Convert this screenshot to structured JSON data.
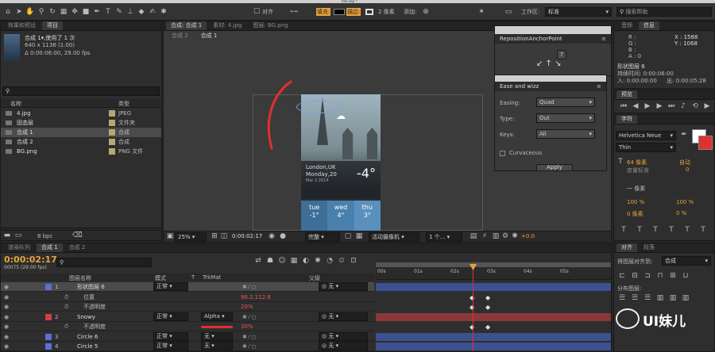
{
  "app": {
    "title": "Ae6.aep *",
    "workspace_label": "工作区:",
    "workspace_value": "标准",
    "search_placeholder": "搜索帮助"
  },
  "toolbar": {
    "align_label": "对齐",
    "fill_label": "填充:",
    "stroke_label": "描边:",
    "stroke_size": "2 像素",
    "add_label": "添加:"
  },
  "project": {
    "tabs": [
      "效果和预设",
      "项目"
    ],
    "comp_name": "合成 1▾,使用了 1 次",
    "comp_size": "640 x 1136 (1.00)",
    "comp_time": "Δ 0:00:06:00, 29.00 fps",
    "headers": {
      "name": "名称",
      "type": "类型"
    },
    "items": [
      {
        "name": "4.jpg",
        "type": "JPEG",
        "color": "#b9a772"
      },
      {
        "name": "固态层",
        "type": "文件夹",
        "color": "#b9a772"
      },
      {
        "name": "合成 1",
        "type": "合成",
        "color": "#b9a772"
      },
      {
        "name": "合成 2",
        "type": "合成",
        "color": "#b9a772"
      },
      {
        "name": "BG.png",
        "type": "PNG 文件",
        "color": "#b9a772"
      }
    ],
    "bpc": "8 bpc"
  },
  "comp_viewer": {
    "tabs": [
      "合成: 合成 1",
      "素材: 4.jpg",
      "图层: BG.png"
    ],
    "flow": [
      "合成 2",
      "合成 1"
    ],
    "zoom": "25%",
    "timecode": "0:00:02:17",
    "quality": "完整",
    "camera": "活动摄像机",
    "views": "1 个...",
    "exposure": "+0.0"
  },
  "phone": {
    "city": "London,UK",
    "day": "Monday,20",
    "date": "Mar 2 2014",
    "temp": "-4°",
    "forecast": [
      {
        "day": "tue",
        "temp": "-1°"
      },
      {
        "day": "wed",
        "temp": "4°"
      },
      {
        "day": "thu",
        "temp": "3°"
      }
    ]
  },
  "anchor_panel": {
    "title": "RepositionAnchorPoint",
    "button": "?"
  },
  "ease_panel": {
    "title": "Ease and wizz",
    "easing_label": "Easing:",
    "easing": "Quad",
    "type_label": "Type:",
    "type": "Out",
    "keys_label": "Keys:",
    "keys": "All",
    "curvaceous": "Curvaceous",
    "apply": "Apply"
  },
  "info": {
    "tabs": [
      "音频",
      "信息"
    ],
    "r": "R :",
    "g": "G :",
    "b": "B :",
    "a": "A : 0",
    "x": "X : 1588",
    "y": "Y : 1068",
    "layer": "形状图层 6",
    "duration": "持续时间: 0:00:06:00",
    "in": "入: 0:00:00:00",
    "out": "出: 0:00:05:28"
  },
  "preview": {
    "title": "预览"
  },
  "character": {
    "title": "字符",
    "font": "Helvetica Neue",
    "style": "Thin",
    "size": "64 像素",
    "auto": "自动",
    "metric": "度量标准",
    "zero": "0",
    "stroke": "一 像素",
    "vscale": "100 %",
    "hscale": "100 %",
    "baseline": "0 像素",
    "tsume": "0 %"
  },
  "timeline": {
    "tabs": [
      "渲染队列",
      "合成 1",
      "合成 2"
    ],
    "time": "0:00:02:17",
    "frames": "00075 (29.00 fps)",
    "headers": {
      "name": "图层名称",
      "mode": "模式",
      "t": "T",
      "trkmat": "TrkMat",
      "parent": "父级"
    },
    "ruler": [
      "00s",
      "01s",
      "02s",
      "03s",
      "04s",
      "05s"
    ],
    "layers": [
      {
        "num": "1",
        "name": "形状图层 6",
        "mode": "正常",
        "trkmat": "",
        "parent": "无",
        "color": "#5a6fd8"
      },
      {
        "num": "",
        "name": "位置",
        "value": "96.2,112.8"
      },
      {
        "num": "",
        "name": "不透明度",
        "value": "20%"
      },
      {
        "num": "2",
        "name": "Snowy",
        "mode": "正常",
        "trkmat": "Alpha",
        "parent": "无",
        "color": "#d04040"
      },
      {
        "num": "",
        "name": "不透明度",
        "value": "30%"
      },
      {
        "num": "3",
        "name": "Circle 6",
        "mode": "正常",
        "trkmat": "无",
        "parent": "无",
        "color": "#5a6fd8"
      },
      {
        "num": "4",
        "name": "Circle 5",
        "mode": "正常",
        "trkmat": "无",
        "parent": "无",
        "color": "#5a6fd8"
      }
    ]
  },
  "align_panel": {
    "tabs": [
      "对齐",
      "段落"
    ],
    "align_to_label": "将图层对齐到:",
    "align_to": "合成",
    "distribute": "分布图层:"
  },
  "watermark": "UI妹儿"
}
